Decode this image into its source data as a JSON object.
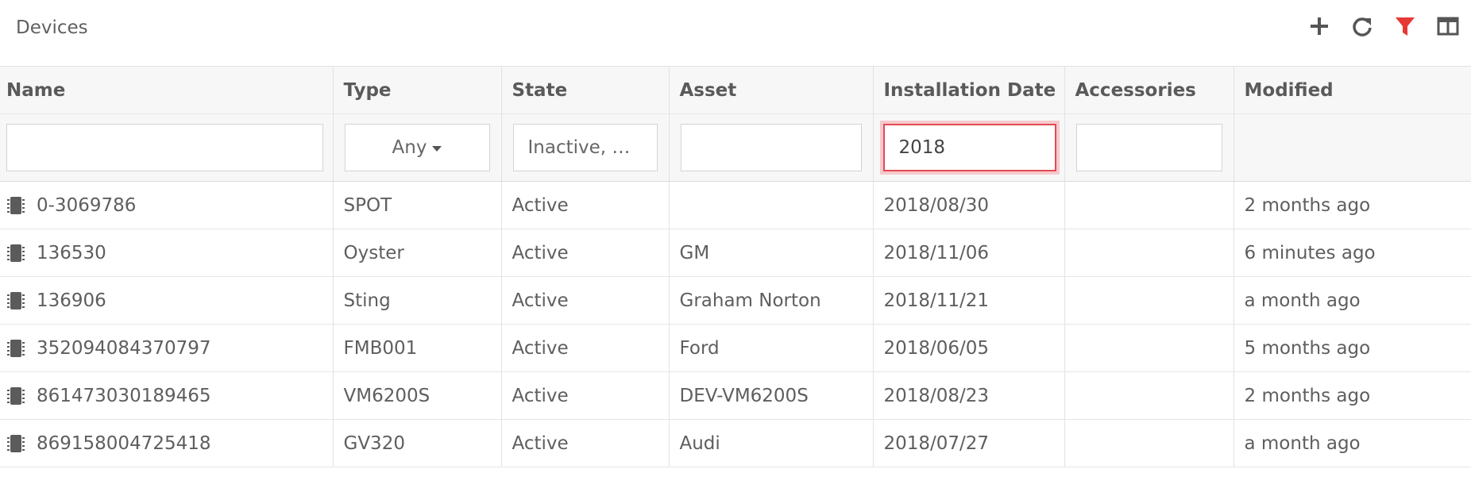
{
  "header": {
    "title": "Devices",
    "toolbar": {
      "add_icon": "plus-icon",
      "refresh_icon": "refresh-icon",
      "filter_icon": "filter-icon",
      "columns_icon": "columns-icon",
      "filter_active_color": "#e53935"
    }
  },
  "table": {
    "columns": [
      "Name",
      "Type",
      "State",
      "Asset",
      "Installation Date",
      "Accessories",
      "Modified"
    ],
    "filters": {
      "name": "",
      "type": "Any",
      "state": "Inactive, …",
      "asset": "",
      "installation_date": "2018",
      "accessories": ""
    },
    "row_icon": "device-chip-icon",
    "rows": [
      {
        "name": "0-3069786",
        "type": "SPOT",
        "state": "Active",
        "asset": "",
        "installation_date": "2018/08/30",
        "accessories": "",
        "modified": "2 months ago"
      },
      {
        "name": "136530",
        "type": "Oyster",
        "state": "Active",
        "asset": "GM",
        "installation_date": "2018/11/06",
        "accessories": "",
        "modified": "6 minutes ago"
      },
      {
        "name": "136906",
        "type": "Sting",
        "state": "Active",
        "asset": "Graham Norton",
        "installation_date": "2018/11/21",
        "accessories": "",
        "modified": "a month ago"
      },
      {
        "name": "352094084370797",
        "type": "FMB001",
        "state": "Active",
        "asset": "Ford",
        "installation_date": "2018/06/05",
        "accessories": "",
        "modified": "5 months ago"
      },
      {
        "name": "861473030189465",
        "type": "VM6200S",
        "state": "Active",
        "asset": "DEV-VM6200S",
        "installation_date": "2018/08/23",
        "accessories": "",
        "modified": "2 months ago"
      },
      {
        "name": "869158004725418",
        "type": "GV320",
        "state": "Active",
        "asset": "Audi",
        "installation_date": "2018/07/27",
        "accessories": "",
        "modified": "a month ago"
      }
    ]
  }
}
